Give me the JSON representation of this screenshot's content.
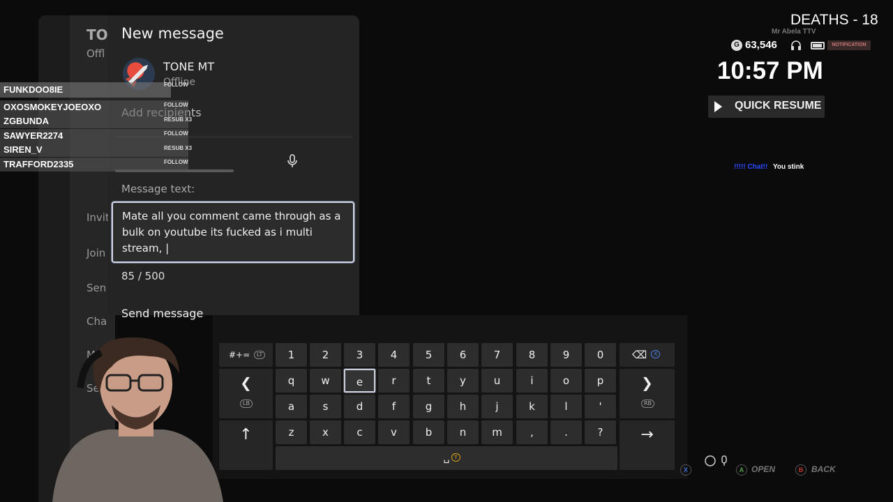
{
  "background_guide": {
    "items": [
      "TO",
      "Offl",
      "Invit",
      "Join",
      "Sen",
      "Cha",
      "Mut",
      "Se"
    ]
  },
  "message_panel": {
    "title": "New message",
    "recipient": {
      "name": "TONE MT",
      "status": "Offline"
    },
    "add_recipients": "Add recipients",
    "message_label": "Message text:",
    "message_text": "Mate all you comment came through as a bulk on youtube its fucked as i multi stream, |",
    "char_count": "85 / 500",
    "send_label": "Send message"
  },
  "chat_overlay": {
    "rows": [
      {
        "name": "FUNKDOO8IE",
        "badge": "FOLLOW"
      },
      {
        "name": "OXOSMOKEYJOEOXO",
        "badge": "FOLLOW"
      },
      {
        "name": "ZGBUNDA",
        "badge": "RESUB X3"
      },
      {
        "name": "SAWYER2274",
        "badge": "FOLLOW"
      },
      {
        "name": "SIREN_V",
        "badge": "RESUB X3"
      },
      {
        "name": "TRAFFORD2335",
        "badge": "FOLLOW"
      }
    ]
  },
  "hud": {
    "deaths": "DEATHS - 18",
    "streamer_tag": "Mr Abela TTV",
    "gamerscore": "63,546",
    "gamerscore_icon": "G",
    "notification": "NOTIFICATION",
    "time": "10:57 PM",
    "quick_resume": "QUICK RESUME",
    "chat_user": "!!!!! Chat!!",
    "chat_message": "You stink"
  },
  "keyboard": {
    "symbols_key": "#+=",
    "symbols_badge": "LT",
    "number_row": [
      "1",
      "2",
      "3",
      "4",
      "5",
      "6",
      "7",
      "8",
      "9",
      "0"
    ],
    "row1": [
      "q",
      "w",
      "e",
      "r",
      "t",
      "y",
      "u",
      "i",
      "o",
      "p"
    ],
    "row2": [
      "a",
      "s",
      "d",
      "f",
      "g",
      "h",
      "j",
      "k",
      "l",
      "'"
    ],
    "row3": [
      "z",
      "x",
      "c",
      "v",
      "b",
      "n",
      "m",
      ",",
      ".",
      "?"
    ],
    "selected_key": "e",
    "backspace_badge": "X",
    "left_badge": "LB",
    "right_badge": "RB",
    "space_badge": "Y",
    "left_arrow": "❮",
    "right_arrow": "❯",
    "shift": "↑",
    "enter": "→",
    "backspace": "⌫",
    "space": "␣"
  },
  "hints": {
    "open": "OPEN",
    "back": "BACK",
    "open_btn": "A",
    "back_btn": "B",
    "x_btn": "X"
  },
  "colors": {
    "panel": "#242424",
    "accent_focus": "#cfd6e8",
    "chat_user": "#2b4bff"
  }
}
